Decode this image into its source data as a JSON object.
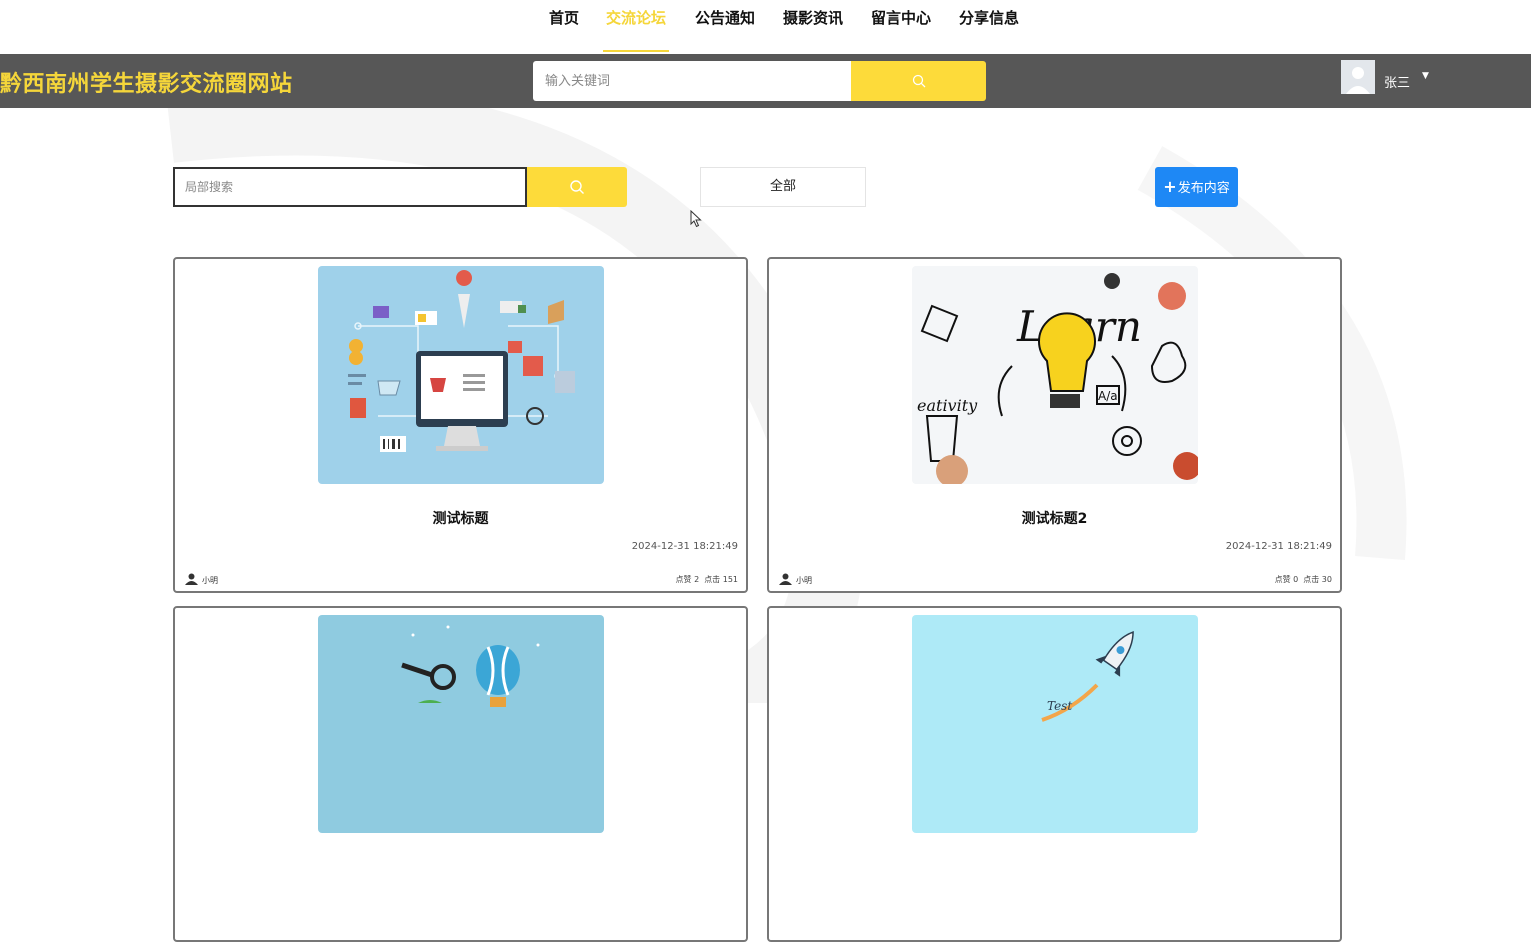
{
  "nav": {
    "items": [
      {
        "label": "首页"
      },
      {
        "label": "交流论坛"
      },
      {
        "label": "公告通知"
      },
      {
        "label": "摄影资讯"
      },
      {
        "label": "留言中心"
      },
      {
        "label": "分享信息"
      }
    ],
    "active_index": 1
  },
  "header": {
    "site_title": "黔西南州学生摄影交流圈网站",
    "search_placeholder": "输入关键词",
    "user_name": "张三"
  },
  "toolbar": {
    "local_search_placeholder": "局部搜索",
    "filter_label": "全部",
    "publish_label": "发布内容"
  },
  "posts": [
    {
      "title": "测试标题",
      "date": "2024-12-31 18:21:49",
      "author": "小明",
      "likes_label": "点赞 2",
      "clicks_label": "点击 151",
      "image": "ecommerce-illustration"
    },
    {
      "title": "测试标题2",
      "date": "2024-12-31 18:21:49",
      "author": "小明",
      "likes_label": "点赞 0",
      "clicks_label": "点击 30",
      "image": "learn-illustration"
    },
    {
      "title": "",
      "date": "",
      "author": "",
      "likes_label": "",
      "clicks_label": "",
      "image": "balloon-illustration"
    },
    {
      "title": "",
      "date": "",
      "author": "",
      "likes_label": "",
      "clicks_label": "",
      "image": "rocket-illustration"
    }
  ],
  "colors": {
    "accent_yellow": "#fddb3a",
    "header_gray": "#575757",
    "publish_blue": "#1e88f5"
  }
}
